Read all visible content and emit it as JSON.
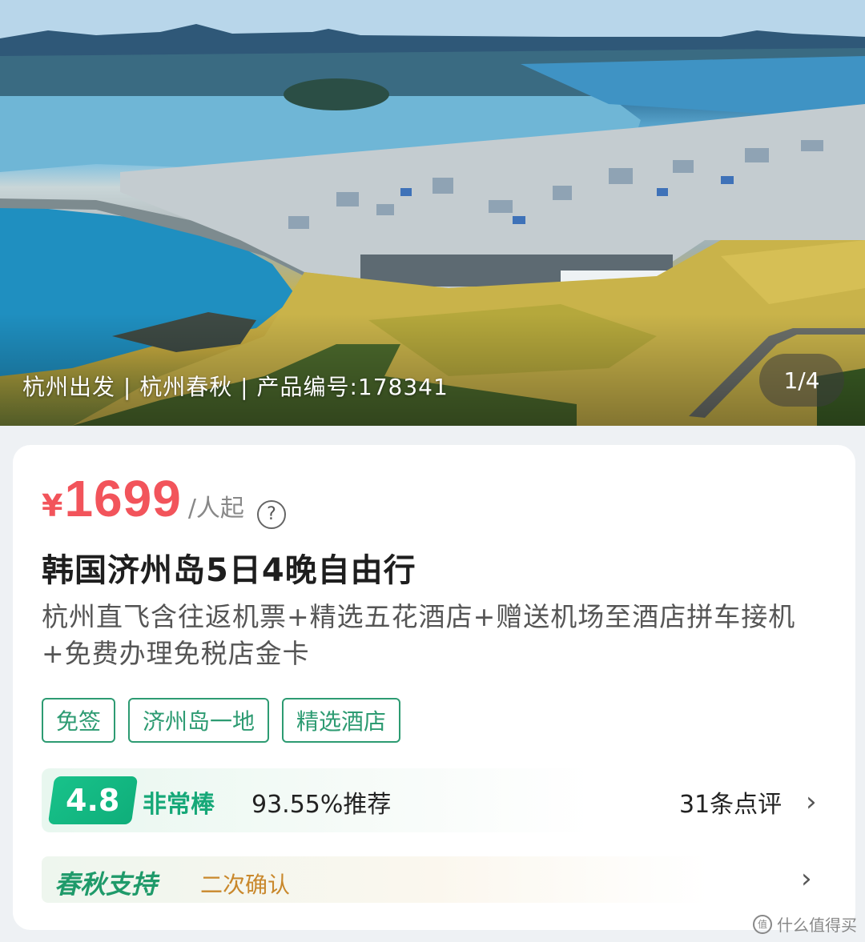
{
  "hero": {
    "caption": "杭州出发 | 杭州春秋 | 产品编号:178341",
    "pager": "1/4"
  },
  "price": {
    "currency": "¥",
    "value": "1699",
    "unit": "/人起",
    "help_icon": "?"
  },
  "product": {
    "title": "韩国济州岛5日4晚自由行",
    "subtitle": "杭州直飞含往返机票+精选五花酒店+赠送机场至酒店拼车接机+免费办理免税店金卡"
  },
  "tags": [
    "免签",
    "济州岛一地",
    "精选酒店"
  ],
  "rating": {
    "score": "4.8",
    "label": "非常棒",
    "recommend": "93.55%推荐",
    "reviews": "31条点评"
  },
  "support": {
    "logo_text": "春秋支持",
    "text": "二次确认"
  },
  "chevron": "›",
  "watermark": {
    "icon": "值",
    "text": "什么值得买"
  },
  "colors": {
    "price": "#f2545b",
    "accent_green": "#2d9b72",
    "score_green": "#16a878",
    "support_orange": "#c9882c"
  }
}
